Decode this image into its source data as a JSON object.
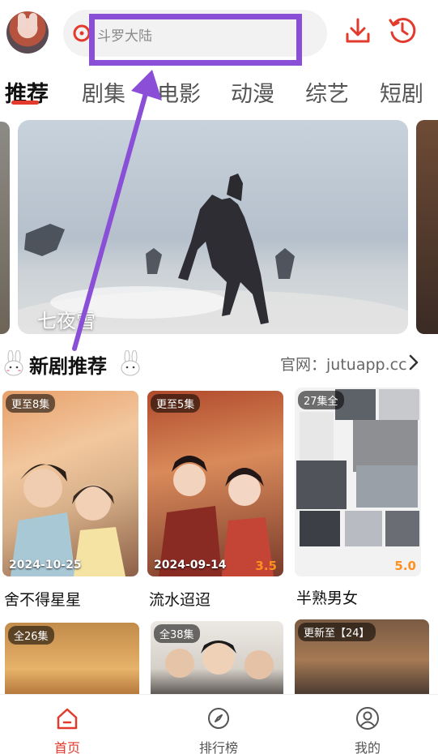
{
  "header": {
    "search_placeholder": "斗罗大陆",
    "icons": {
      "avatar": "bunny-avatar",
      "search": "search-icon",
      "download": "download-icon",
      "history": "history-icon"
    },
    "accent": "#e23a2c"
  },
  "tabs": [
    {
      "label": "推荐",
      "active": true
    },
    {
      "label": "剧集"
    },
    {
      "label": "电影"
    },
    {
      "label": "动漫"
    },
    {
      "label": "综艺"
    },
    {
      "label": "短剧"
    }
  ],
  "banner": {
    "title": "七夜雪"
  },
  "section": {
    "title": "新剧推荐",
    "link": "官网：jutuapp.cc"
  },
  "cards": [
    {
      "badge": "更至8集",
      "date": "2024-10-25",
      "title": "舍不得星星"
    },
    {
      "badge": "更至5集",
      "date": "2024-09-14",
      "score": "3.5",
      "title": "流水迢迢"
    },
    {
      "badge": "27集全",
      "score": "5.0",
      "title": "半熟男女"
    },
    {
      "badge": "全26集"
    },
    {
      "badge": "全38集"
    },
    {
      "badge": "更新至【24】"
    }
  ],
  "bottom_nav": [
    {
      "label": "首页",
      "icon": "home-icon",
      "active": true
    },
    {
      "label": "排行榜",
      "icon": "compass-icon"
    },
    {
      "label": "我的",
      "icon": "user-icon"
    }
  ],
  "annotation_color": "#8a4fd6"
}
